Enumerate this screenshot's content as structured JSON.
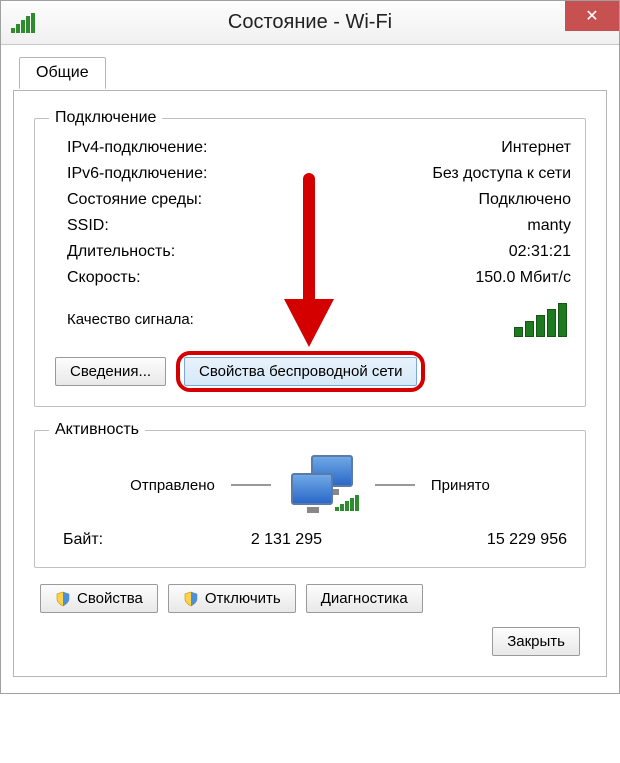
{
  "title": "Состояние - Wi-Fi",
  "tab": "Общие",
  "connection": {
    "legend": "Подключение",
    "rows": [
      {
        "label": "IPv4-подключение:",
        "value": "Интернет"
      },
      {
        "label": "IPv6-подключение:",
        "value": "Без доступа к сети"
      },
      {
        "label": "Состояние среды:",
        "value": "Подключено"
      },
      {
        "label": "SSID:",
        "value": "manty"
      },
      {
        "label": "Длительность:",
        "value": "02:31:21"
      },
      {
        "label": "Скорость:",
        "value": "150.0 Мбит/с"
      }
    ],
    "signal_label": "Качество сигнала:",
    "details_btn": "Сведения...",
    "wireless_props_btn": "Свойства беспроводной сети"
  },
  "activity": {
    "legend": "Активность",
    "sent_label": "Отправлено",
    "recv_label": "Принято",
    "bytes_label": "Байт:",
    "bytes_sent": "2 131 295",
    "bytes_recv": "15 229 956"
  },
  "buttons": {
    "properties": "Свойства",
    "disable": "Отключить",
    "diagnose": "Диагностика",
    "close": "Закрыть"
  }
}
